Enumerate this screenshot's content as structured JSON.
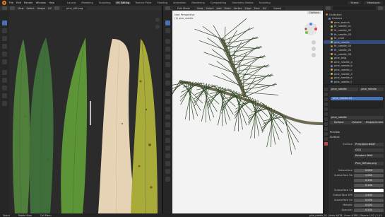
{
  "topbar": {
    "menus": [
      "File",
      "Edit",
      "Render",
      "Window",
      "Help"
    ],
    "workspaces": [
      "Layout",
      "Modeling",
      "Sculpting",
      "UV Editing",
      "Texture Paint",
      "Shading",
      "Animation",
      "Rendering",
      "Compositing",
      "Geometry Nodes",
      "Scripting"
    ],
    "active_workspace": "UV Editing",
    "scene": "Scene",
    "view_layer": "ViewLayer"
  },
  "uv_editor": {
    "header_items": [
      "View",
      "Select",
      "Image",
      "UV"
    ],
    "image_name": "pine_diff.png",
    "leaf_colors": [
      "#4f7f3a",
      "#3f6e3a",
      "#5d9438",
      "#e6d2b4",
      "#a8aa3a"
    ]
  },
  "viewport": {
    "mode": "Edit Mode",
    "header_items": [
      "View",
      "Select",
      "Add",
      "Mesh",
      "Vertex",
      "Edge",
      "Face",
      "UV"
    ],
    "transform": "Global",
    "options": "Options",
    "info_lines": [
      "User Perspective",
      "(1) pine_needle"
    ],
    "colors": {
      "background": "#f3f3f3",
      "needles": "#33492a",
      "stem": "#6d6a52"
    }
  },
  "outliner": {
    "title": "Scene Collection",
    "items": [
      "Collection",
      "Camera",
      "pine_branch",
      "fir_needle_01",
      "fir_needle_02",
      "fir_needle_03",
      "fir_cone",
      "pine_needle",
      "fir_needle_04",
      "fir_needle_05",
      "fir_needle_06",
      "pine_twig",
      "pine_needle_a",
      "pine_needle_b",
      "pine_needle_c",
      "pine_needle_d",
      "pine_needle_e",
      "pine_needle_f"
    ],
    "selected_index": 7
  },
  "properties": {
    "object_name": "pine_needle",
    "material_name": "pine_needle",
    "material_slot": "pine_needle.02",
    "tabs": [
      "Surface",
      "Volume",
      "Displacement"
    ],
    "sections": [
      "Preview",
      "Surface"
    ],
    "surface_shader": "Principled BSDF",
    "distribution": "GGX",
    "subsurface_method": "Random Walk",
    "base_color": "Pine_Diffuse.png",
    "fields": [
      {
        "label": "Subsurface",
        "value": "0.000"
      },
      {
        "label": "Subsurface Ra",
        "value": "1.000"
      },
      {
        "label": "",
        "value": "0.200"
      },
      {
        "label": "",
        "value": "0.100"
      },
      {
        "label": "Subsurface Co",
        "value": ""
      },
      {
        "label": "Subsurface IOR",
        "value": "1.400"
      },
      {
        "label": "Subsurface An",
        "value": "0.000"
      },
      {
        "label": "Metallic",
        "value": "0.000"
      },
      {
        "label": "Specular",
        "value": "0.500"
      }
    ],
    "colors": {
      "subsurface": "#ffffff",
      "base": "#3b5a2c"
    }
  },
  "statusbar": {
    "hints": [
      "Select",
      "Rotate View",
      "Call Menu"
    ],
    "stats": "pine_needle_01 | Verts 9/478 | Faces 4/188 | Objects 1/52 | 3.4.1"
  }
}
